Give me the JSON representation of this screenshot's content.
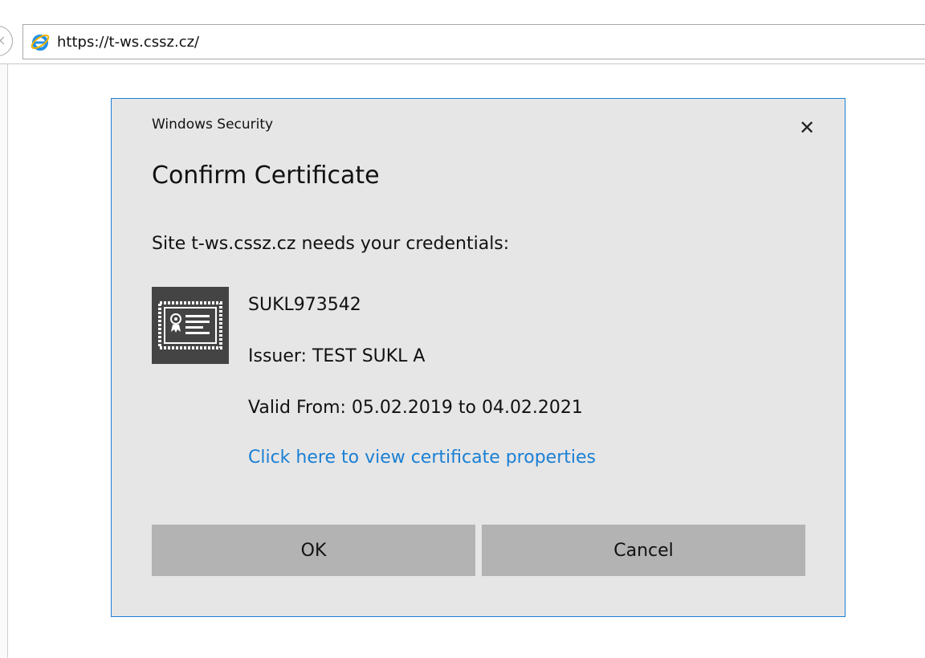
{
  "browser": {
    "url": "https://t-ws.cssz.cz/"
  },
  "dialog": {
    "window_title": "Windows Security",
    "close_glyph": "✕",
    "heading": "Confirm Certificate",
    "message": "Site t-ws.cssz.cz needs your credentials:",
    "certificate": {
      "icon": "certificate-icon",
      "name": "SUKL973542",
      "issuer": "Issuer: TEST SUKL A",
      "valid": "Valid From: 05.02.2019 to 04.02.2021",
      "properties_link": "Click here to view certificate properties"
    },
    "buttons": {
      "ok": "OK",
      "cancel": "Cancel"
    }
  },
  "colors": {
    "accent": "#1e7fd6",
    "link": "#1a7fd4",
    "dialog_bg": "#e6e6e6",
    "button_bg": "#b3b3b3"
  }
}
